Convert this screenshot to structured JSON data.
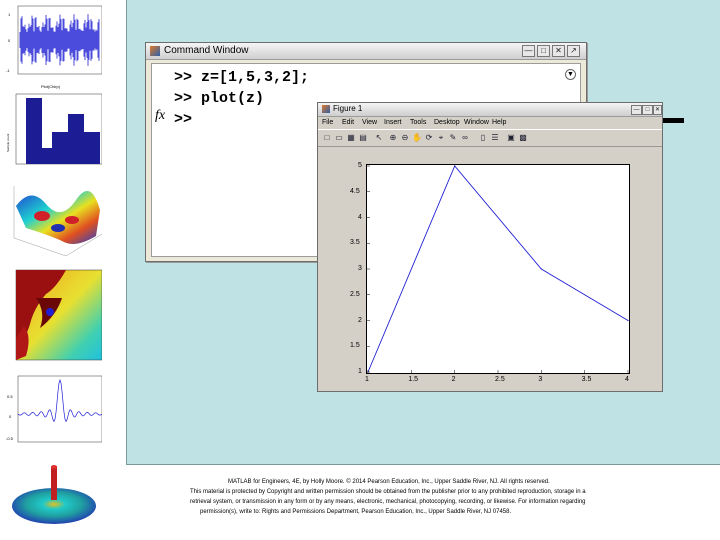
{
  "command_window": {
    "title": "Command Window",
    "prompt_lines": [
      ">> z=[1,5,3,2];",
      ">> plot(z)",
      ">>"
    ],
    "fx_label": "fx",
    "buttons": [
      "minimize-icon",
      "maximize-icon",
      "close-icon"
    ]
  },
  "figure_window": {
    "title": "Figure 1",
    "menu": [
      "File",
      "Edit",
      "View",
      "Insert",
      "Tools",
      "Desktop",
      "Window",
      "Help"
    ],
    "toolbar_icons": [
      "new-file-icon",
      "open-icon",
      "save-icon",
      "print-icon",
      "pointer-icon",
      "zoom-in-icon",
      "zoom-out-icon",
      "pan-icon",
      "rotate-icon",
      "data-cursor-icon",
      "brush-icon",
      "link-icon",
      "colorbar-icon",
      "legend-icon",
      "hide-plot-tools-icon",
      "show-plot-tools-icon"
    ],
    "title_buttons": [
      "minimize-icon",
      "maximize-icon",
      "close-icon"
    ]
  },
  "chart_data": {
    "type": "line",
    "x": [
      1,
      2,
      3,
      4
    ],
    "y": [
      1,
      5,
      3,
      2
    ],
    "xlim": [
      1,
      4
    ],
    "ylim": [
      1,
      5
    ],
    "xticks": [
      "1",
      "1.5",
      "2",
      "2.5",
      "3",
      "3.5",
      "4"
    ],
    "yticks": [
      "1",
      "1.5",
      "2",
      "2.5",
      "3",
      "3.5",
      "4",
      "4.5",
      "5"
    ],
    "line_color": "#1f1fd4",
    "grid": false
  },
  "thumbnails": {
    "plot1_title": "Plot(Chirp)",
    "plot1_yticks": [
      "1",
      "0.5",
      "0",
      "-0.5",
      "-1"
    ],
    "plot1_xticks": [
      "0",
      "1",
      "2",
      "3",
      "4",
      "5",
      "6",
      "x 10"
    ],
    "plot2_ylabel": "Sample count (histogram value)"
  },
  "footer": {
    "line1": "MATLAB for Engineers, 4E, by Holly Moore. © 2014 Pearson Education, Inc., Upper Saddle River, NJ. All rights reserved.",
    "line2": "This material is protected by Copyright and written permission should be obtained from the publisher prior to any prohibited reproduction, storage in a",
    "line3": "retrieval system, or transmission in any form or by any means, electronic, mechanical, photocopying, recording, or likewise. For information regarding",
    "line4": "permission(s), write to: Rights and Permissions Department, Pearson Education, Inc., Upper Saddle River, NJ 07458."
  },
  "colors": {
    "panel_bg": "#bfe2e5",
    "line": "#1f1fd4"
  }
}
